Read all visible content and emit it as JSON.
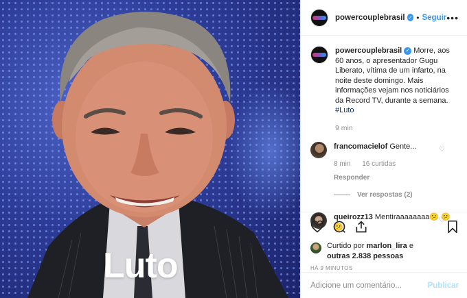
{
  "photo": {
    "overlay_text": "Luto"
  },
  "header": {
    "username": "powercouplebrasil",
    "follow_label": "Seguir",
    "more_label": "•••"
  },
  "caption": {
    "username": "powercouplebrasil",
    "text": "Morre, aos 60 anos, o apresentador Gugu Liberato, vítima de um infarto, na noite deste domingo. Mais informações vejam nos noticiários da Record TV, durante a semana.",
    "hashtag": "#Luto",
    "time": "9 min"
  },
  "comments": [
    {
      "username": "francomacielof",
      "text": "Gente...",
      "time": "8 min",
      "likes": "16 curtidas",
      "reply_label": "Responder",
      "view_replies": "Ver respostas (2)"
    },
    {
      "username": "queirozz13",
      "text": "Mentiraaaaaaaa😕 😕😕"
    }
  ],
  "likes": {
    "prefix": "Curtido por",
    "user": "marlon_lira",
    "conj": "e",
    "others": "outras 2.838 pessoas"
  },
  "posted_ago": "HÁ 9 MINUTOS",
  "add_comment": {
    "placeholder": "Adicione um comentário...",
    "publish_label": "Publicar"
  },
  "colors": {
    "link_blue": "#3897f0",
    "publish_disabled": "#b2dffc",
    "muted": "#8e8e8e"
  }
}
